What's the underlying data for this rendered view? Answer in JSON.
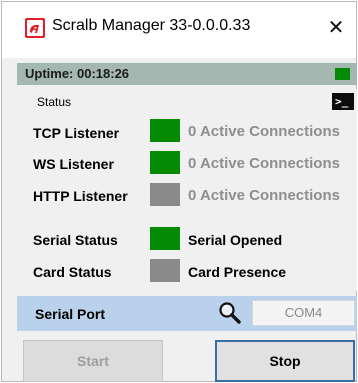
{
  "window": {
    "title": "Scralb Manager 33-0.0.0.33",
    "close_glyph": "✕",
    "app_icon": "scralb-logo-icon",
    "app_icon_color": "#e31e24"
  },
  "uptime": {
    "text": "Uptime: 00:18:26",
    "indicator_color": "#048a04"
  },
  "status": {
    "caption": "Status",
    "console_icon": "terminal-icon",
    "console_glyph": ">_",
    "rows": [
      {
        "label": "TCP Listener",
        "indicator": "green",
        "value": "0 Active Connections"
      },
      {
        "label": "WS Listener",
        "indicator": "green",
        "value": "0 Active Connections"
      },
      {
        "label": "HTTP Listener",
        "indicator": "gray",
        "value": "0 Active Connections"
      },
      {
        "label": "Serial Status",
        "indicator": "green",
        "value": "Serial Opened"
      },
      {
        "label": "Card Status",
        "indicator": "gray",
        "value": "Card Presence"
      }
    ]
  },
  "serial_port": {
    "label": "Serial Port",
    "search_icon": "magnifier-icon",
    "selected": "COM4"
  },
  "buttons": {
    "start_label": "Start",
    "stop_label": "Stop"
  },
  "colors": {
    "green": "#048a04",
    "gray": "#8a8a8a",
    "uptime_bar": "#a4b8b1",
    "serial_bar": "#b9d1ea",
    "stop_border": "#3a6ea5"
  }
}
